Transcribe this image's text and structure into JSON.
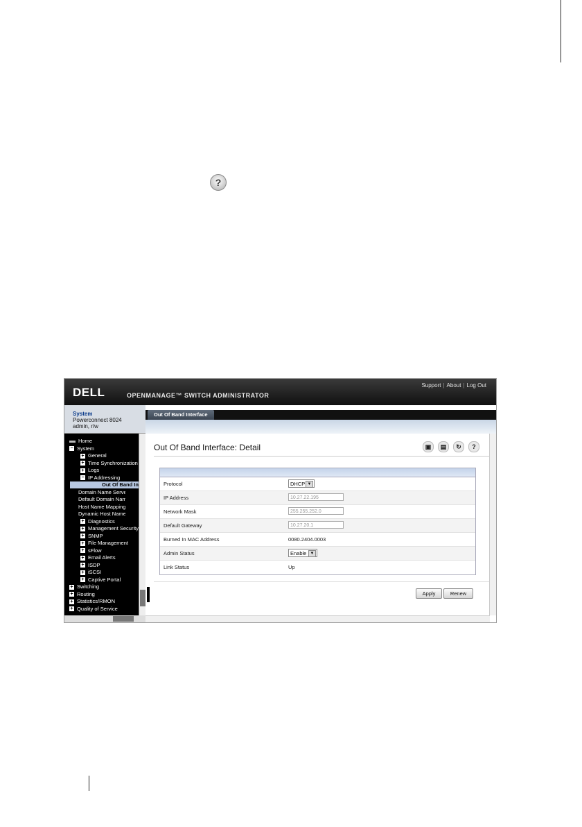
{
  "header": {
    "brand": "DELL",
    "product": "OPENMANAGE™ SWITCH ADMINISTRATOR",
    "links": [
      "Support",
      "About",
      "Log Out"
    ]
  },
  "system_box": {
    "title": "System",
    "device": "Powerconnect 8024",
    "user": "admin, r/w"
  },
  "nav": {
    "items": [
      {
        "label": "Home",
        "expander": ""
      },
      {
        "label": "System",
        "expander": "−"
      },
      {
        "label": "General",
        "expander": "+"
      },
      {
        "label": "Time Synchronization",
        "expander": "+"
      },
      {
        "label": "Logs",
        "expander": "+"
      },
      {
        "label": "IP Addressing",
        "expander": "−"
      },
      {
        "label": "Out Of Band Interface",
        "expander": ""
      },
      {
        "label": "Domain Name Server",
        "expander": ""
      },
      {
        "label": "Default Domain Name",
        "expander": ""
      },
      {
        "label": "Host Name Mapping",
        "expander": ""
      },
      {
        "label": "Dynamic Host Name",
        "expander": ""
      },
      {
        "label": "Diagnostics",
        "expander": "+"
      },
      {
        "label": "Management Security",
        "expander": "+"
      },
      {
        "label": "SNMP",
        "expander": "+"
      },
      {
        "label": "File Management",
        "expander": "+"
      },
      {
        "label": "sFlow",
        "expander": "+"
      },
      {
        "label": "Email Alerts",
        "expander": "+"
      },
      {
        "label": "ISDP",
        "expander": "+"
      },
      {
        "label": "iSCSI",
        "expander": "+"
      },
      {
        "label": "Captive Portal",
        "expander": "+"
      },
      {
        "label": "Switching",
        "expander": "+"
      },
      {
        "label": "Routing",
        "expander": "+"
      },
      {
        "label": "Statistics/RMON",
        "expander": "+"
      },
      {
        "label": "Quality of Service",
        "expander": "+"
      }
    ]
  },
  "tab": {
    "label": "Out Of Band Interface"
  },
  "page": {
    "title": "Out Of Band Interface: Detail"
  },
  "form": {
    "protocol": {
      "label": "Protocol",
      "value": "DHCP"
    },
    "ip_address": {
      "label": "IP Address",
      "value": "10.27.22.195"
    },
    "network_mask": {
      "label": "Network Mask",
      "value": "255.255.252.0"
    },
    "default_gateway": {
      "label": "Default Gateway",
      "value": "10.27.20.1"
    },
    "burned_mac": {
      "label": "Burned In MAC Address",
      "value": "0080.2404.0003"
    },
    "admin_status": {
      "label": "Admin Status",
      "value": "Enable"
    },
    "link_status": {
      "label": "Link Status",
      "value": "Up"
    }
  },
  "buttons": {
    "apply": "Apply",
    "renew": "Renew"
  }
}
